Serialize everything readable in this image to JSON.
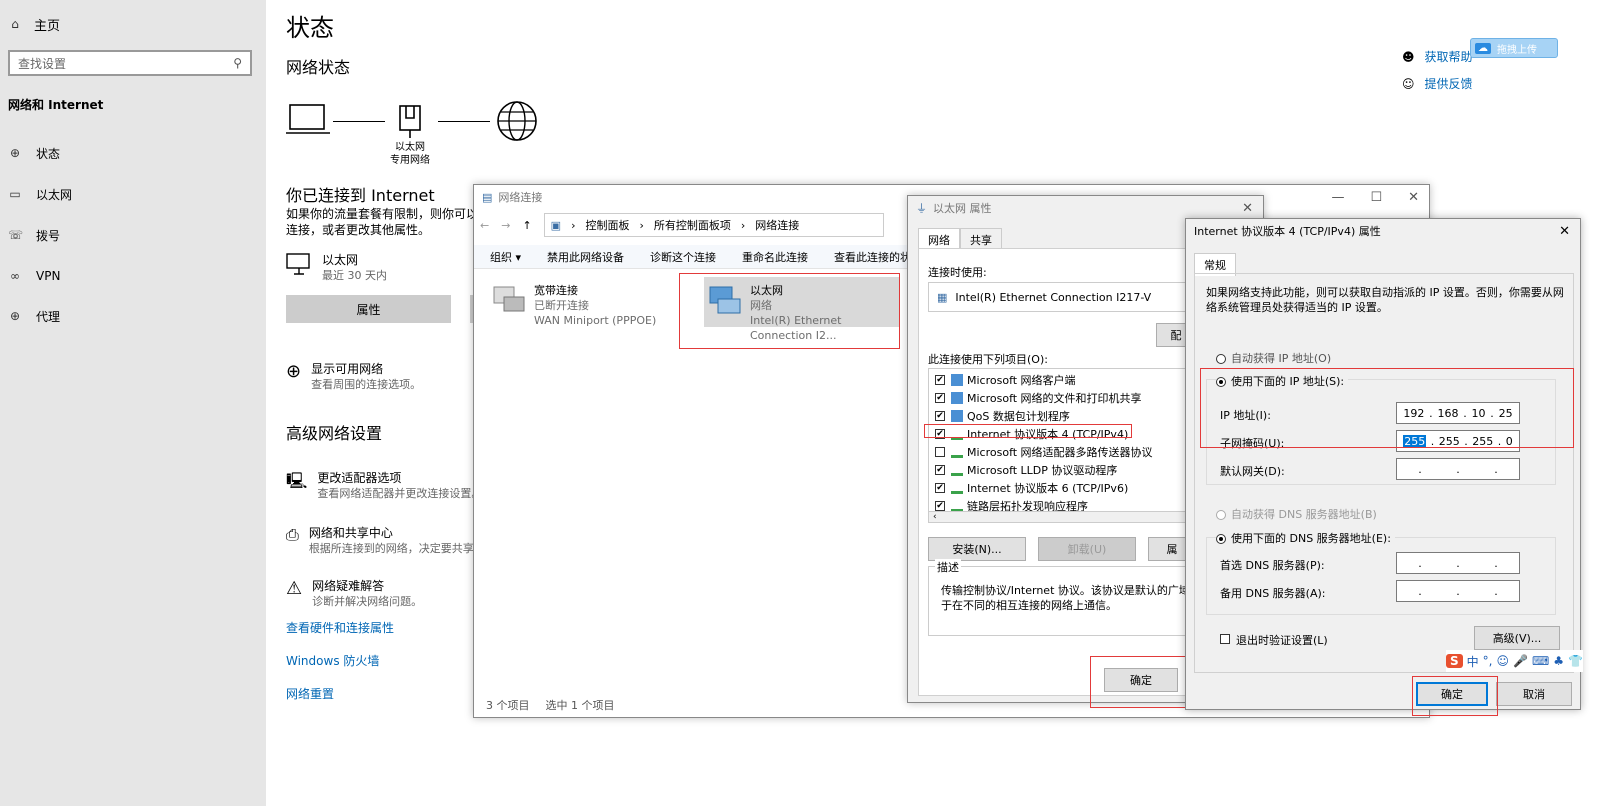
{
  "sidebar": {
    "home": "主页",
    "search_placeholder": "查找设置",
    "category": "网络和 Internet",
    "items": [
      "状态",
      "以太网",
      "拨号",
      "VPN",
      "代理"
    ]
  },
  "main": {
    "title": "状态",
    "network_status": "网络状态",
    "diagram": {
      "adapter_label": "以太网",
      "network_label": "专用网络"
    },
    "connected_heading": "你已连接到 Internet",
    "connected_desc_line1": "如果你的流量套餐有限制，则你可以",
    "connected_desc_line2": "连接，或者更改其他属性。",
    "adapter_name": "以太网",
    "adapter_sub": "最近 30 天内",
    "properties_button": "属性",
    "show_networks_title": "显示可用网络",
    "show_networks_sub": "查看周围的连接选项。",
    "advanced_heading": "高级网络设置",
    "adv_items": [
      {
        "title": "更改适配器选项",
        "sub": "查看网络适配器并更改连接设置。"
      },
      {
        "title": "网络和共享中心",
        "sub": "根据所连接到的网络，决定要共享"
      },
      {
        "title": "网络疑难解答",
        "sub": "诊断并解决网络问题。"
      }
    ],
    "links": [
      "查看硬件和连接属性",
      "Windows 防火墙",
      "网络重置"
    ]
  },
  "help": {
    "get_help": "获取帮助",
    "feedback": "提供反馈",
    "upload": "拖拽上传"
  },
  "netconn": {
    "title": "网络连接",
    "breadcrumb": [
      "控制面板",
      "所有控制面板项",
      "网络连接"
    ],
    "toolbar": [
      "组织 ▾",
      "禁用此网络设备",
      "诊断这个连接",
      "重命名此连接",
      "查看此连接的状态"
    ],
    "adapters": [
      {
        "name": "宽带连接",
        "status": "已断开连接",
        "device": "WAN Miniport (PPPOE)"
      },
      {
        "name": "以太网",
        "status": "网络",
        "device": "Intel(R) Ethernet Connection I2..."
      }
    ],
    "status_count": "3 个项目",
    "status_selected": "选中 1 个项目"
  },
  "ethprops": {
    "title": "以太网 属性",
    "tabs": [
      "网络",
      "共享"
    ],
    "connect_using": "连接时使用:",
    "device": "Intel(R) Ethernet Connection I217-V",
    "configure_partial": "配",
    "items_label": "此连接使用下列项目(O):",
    "items": [
      {
        "checked": true,
        "label": "Microsoft 网络客户端"
      },
      {
        "checked": true,
        "label": "Microsoft 网络的文件和打印机共享"
      },
      {
        "checked": true,
        "label": "QoS 数据包计划程序"
      },
      {
        "checked": true,
        "label": "Internet 协议版本 4 (TCP/IPv4)"
      },
      {
        "checked": false,
        "label": "Microsoft 网络适配器多路传送器协议"
      },
      {
        "checked": true,
        "label": "Microsoft LLDP 协议驱动程序"
      },
      {
        "checked": true,
        "label": "Internet 协议版本 6 (TCP/IPv6)"
      },
      {
        "checked": true,
        "label": "链路层拓扑发现响应程序"
      }
    ],
    "install": "安装(N)...",
    "uninstall": "卸载(U)",
    "props_partial": "属",
    "desc_label": "描述",
    "desc_line1": "传输控制协议/Internet 协议。该协议是默认的广域网络",
    "desc_line2": "于在不同的相互连接的网络上通信。",
    "ok": "确定"
  },
  "ipv4": {
    "title": "Internet 协议版本 4 (TCP/IPv4) 属性",
    "tab": "常规",
    "intro_line1": "如果网络支持此功能，则可以获取自动指派的 IP 设置。否则，你需要从网",
    "intro_line2": "络系统管理员处获得适当的 IP 设置。",
    "auto_ip": "自动获得 IP 地址(O)",
    "manual_ip": "使用下面的 IP 地址(S):",
    "ip_label": "IP 地址(I):",
    "ip": [
      "192",
      "168",
      "10",
      "25"
    ],
    "mask_label": "子网掩码(U):",
    "mask": [
      "255",
      "255",
      "255",
      "0"
    ],
    "gateway_label": "默认网关(D):",
    "auto_dns": "自动获得 DNS 服务器地址(B)",
    "manual_dns": "使用下面的 DNS 服务器地址(E):",
    "dns1_label": "首选 DNS 服务器(P):",
    "dns2_label": "备用 DNS 服务器(A):",
    "validate": "退出时验证设置(L)",
    "advanced": "高级(V)...",
    "ok": "确定",
    "cancel": "取消"
  },
  "ime": {
    "lang": "中"
  },
  "colors": {
    "accent": "#0078d7",
    "highlight_red": "#e23a3a",
    "link": "#0066b4"
  }
}
